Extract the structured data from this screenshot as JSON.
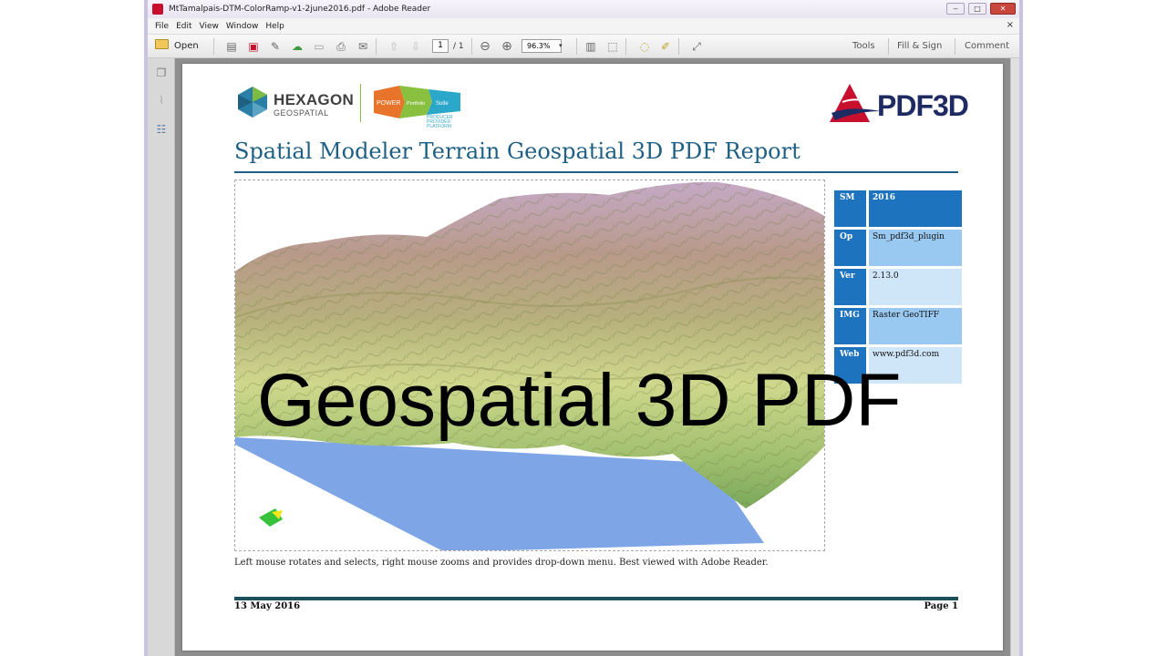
{
  "window": {
    "title": "MtTamalpais-DTM-ColorRamp-v1-2june2016.pdf - Adobe Reader",
    "controls": {
      "minimize": "‒",
      "maximize": "□",
      "close": "✕"
    }
  },
  "menu": {
    "items": [
      "File",
      "Edit",
      "View",
      "Window",
      "Help"
    ],
    "doc_close": "×"
  },
  "toolbar": {
    "open_label": "Open",
    "page_current": "1",
    "page_total": "/ 1",
    "zoom": "96.3%",
    "zoom_dropdown": "▾",
    "tools_label": "Tools",
    "fill_sign_label": "Fill & Sign",
    "comment_label": "Comment"
  },
  "logos": {
    "hexagon": "HEXAGON",
    "geospatial": "GEOSPATIAL",
    "power": "POWER",
    "portfolio": "Portfolio",
    "suite": "Suite",
    "tagline": [
      "PRODUCER",
      "PROVIDER",
      "PLATFORM"
    ],
    "pdf3d": "PDF3D"
  },
  "report": {
    "title": "Spatial Modeler Terrain Geospatial 3D PDF Report",
    "overlay": "Geospatial 3D PDF",
    "caption": "Left mouse rotates and selects, right mouse zooms and provides drop-down menu. Best viewed with Adobe Reader.",
    "date": "13 May 2016",
    "page": "Page 1"
  },
  "info_table": [
    {
      "key": "SM",
      "value": "2016"
    },
    {
      "key": "Op",
      "value": "Sm_pdf3d_plugin"
    },
    {
      "key": "Ver",
      "value": "2.13.0"
    },
    {
      "key": "IMG",
      "value": "Raster GeoTIFF"
    },
    {
      "key": "Web",
      "value": "www.pdf3d.com"
    }
  ],
  "colors": {
    "title_blue": "#1e5f85",
    "key_blue": "#1e73be",
    "water_blue": "#7ea6e6",
    "terrain_low": "#c9d98e",
    "terrain_mid": "#a8b07a",
    "terrain_high": "#b493a8"
  }
}
